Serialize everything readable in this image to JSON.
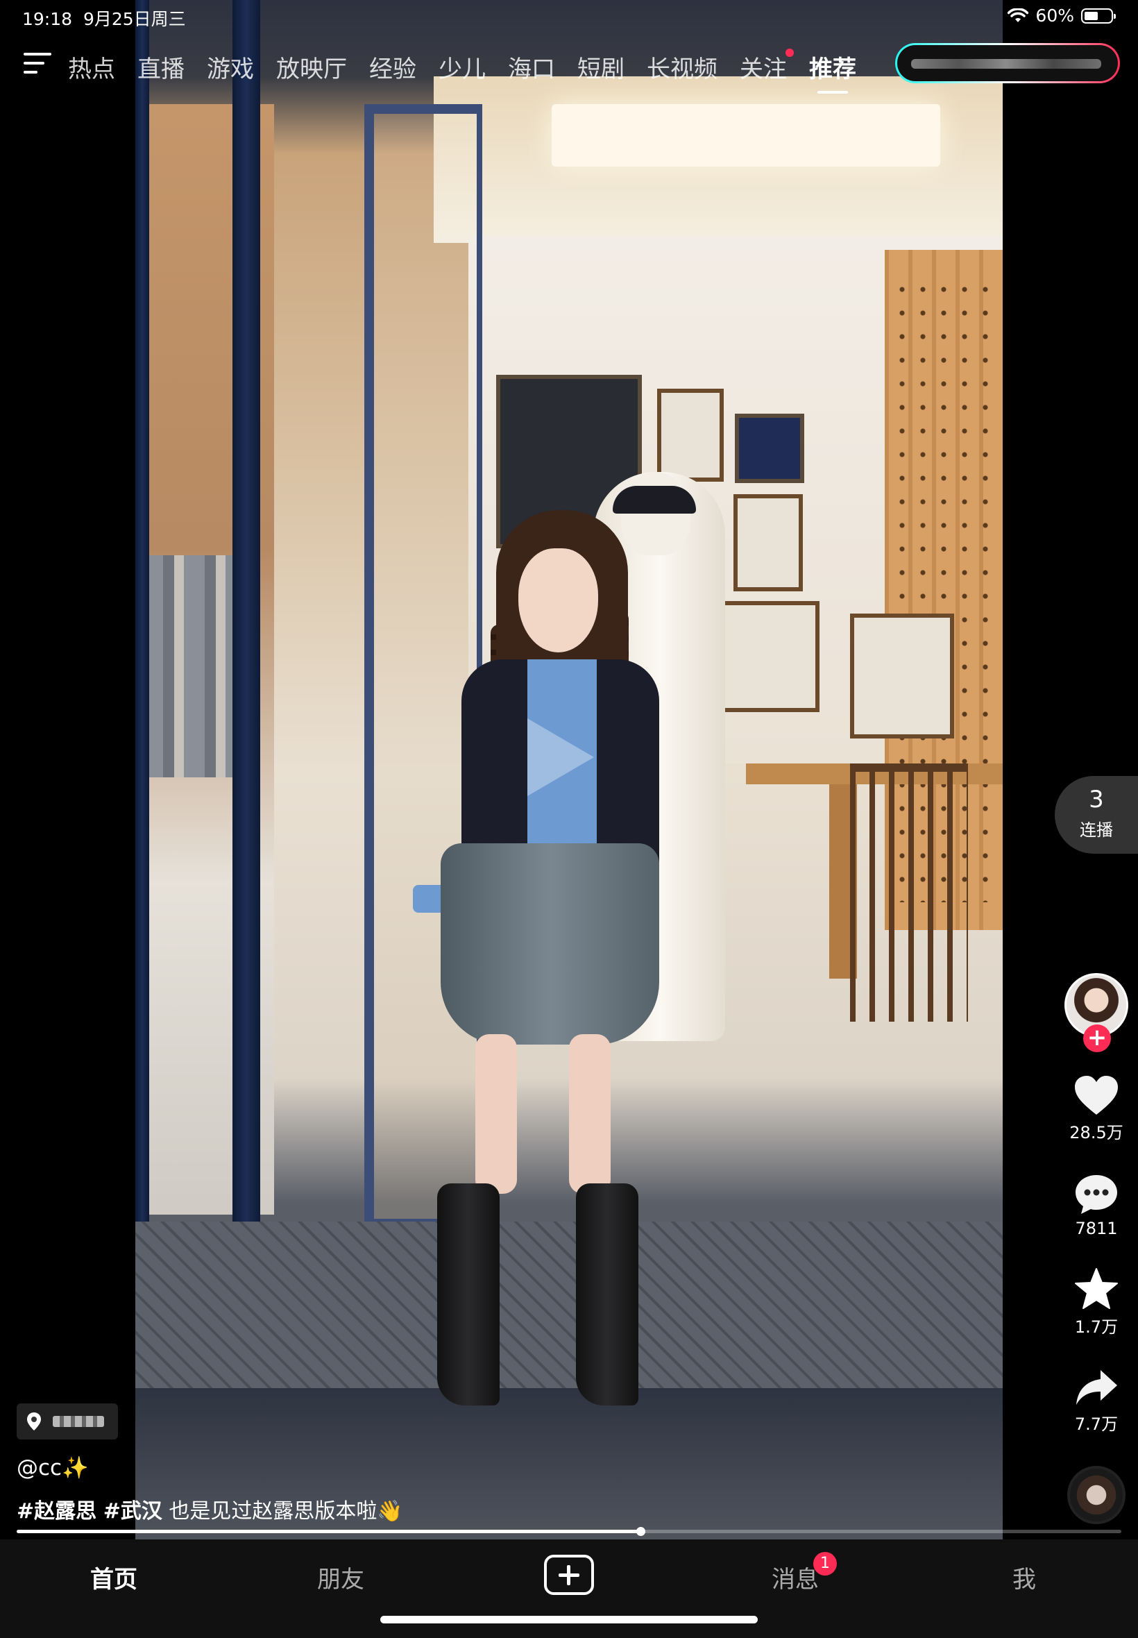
{
  "status_bar": {
    "time": "19:18",
    "date": "9月25日周三",
    "battery": "60%",
    "battery_level": 0.6
  },
  "top_nav": {
    "menu_icon": "hamburger-menu-icon",
    "tabs": [
      {
        "label": "热点",
        "active": false
      },
      {
        "label": "直播",
        "active": false
      },
      {
        "label": "游戏",
        "active": false
      },
      {
        "label": "放映厅",
        "active": false
      },
      {
        "label": "经验",
        "active": false
      },
      {
        "label": "少儿",
        "active": false
      },
      {
        "label": "海口",
        "active": false
      },
      {
        "label": "短剧",
        "active": false
      },
      {
        "label": "长视频",
        "active": false
      },
      {
        "label": "关注",
        "active": false,
        "dot": true
      },
      {
        "label": "推荐",
        "active": true
      }
    ]
  },
  "right_rail": {
    "autoplay": {
      "count": "3",
      "label": "连播"
    },
    "like_count": "28.5万",
    "comment_count": "7811",
    "favorite_count": "1.7万",
    "share_count": "7.7万",
    "follow_symbol": "+"
  },
  "caption": {
    "author": "@cc✨",
    "tag1": "#赵露思",
    "tag2": "#武汉",
    "text": "也是见过赵露思版本啦👋"
  },
  "progress": {
    "value": 0.565
  },
  "bottom_bar": {
    "home": "首页",
    "friends": "朋友",
    "messages": "消息",
    "messages_badge": "1",
    "me": "我"
  },
  "colors": {
    "accent": "#fe2c55",
    "cyan": "#25f4ee"
  }
}
